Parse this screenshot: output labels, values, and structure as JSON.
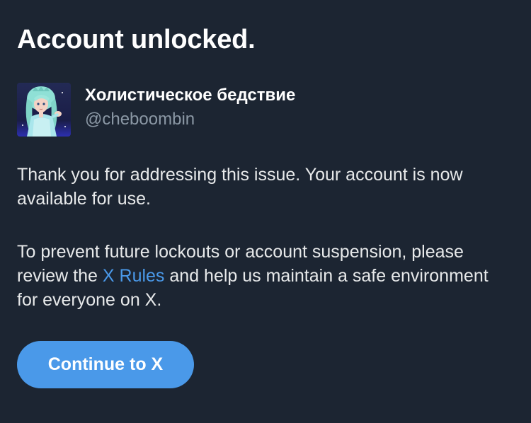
{
  "header": {
    "title": "Account unlocked."
  },
  "account": {
    "display_name": "Холистическое бедствие",
    "handle": "@cheboombin",
    "avatar_icon": "anime-character-avatar"
  },
  "message": {
    "paragraph1": "Thank you for addressing this issue. Your account is now available for use.",
    "paragraph2_before": "To prevent future lockouts or account suspension, please review the ",
    "paragraph2_link": "X Rules",
    "paragraph2_after": " and help us maintain a safe environment for everyone on X."
  },
  "actions": {
    "continue_label": "Continue to X"
  },
  "colors": {
    "background": "#1c2532",
    "accent": "#4a99e9",
    "secondary_text": "#8b98a5"
  }
}
